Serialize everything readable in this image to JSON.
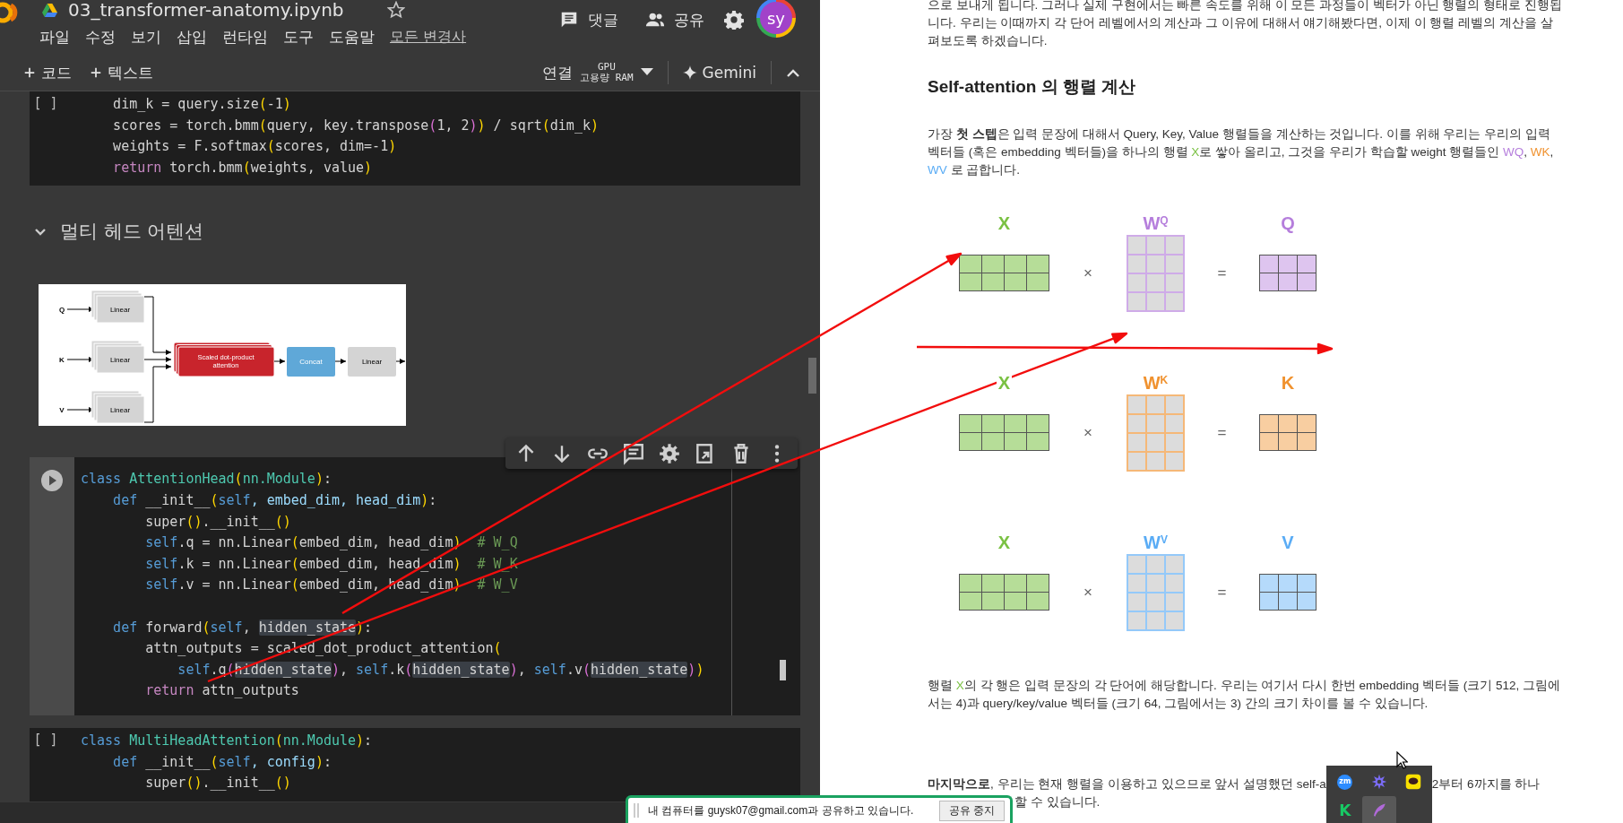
{
  "notebook": {
    "title": "03_transformer-anatomy.ipynb",
    "starred": false,
    "menu": [
      "파일",
      "수정",
      "보기",
      "삽입",
      "런타임",
      "도구",
      "도움말"
    ],
    "save_status": "모든 변경사",
    "actions": [
      {
        "kind": "comment",
        "label": "댓글"
      },
      {
        "kind": "share",
        "label": "공유"
      }
    ],
    "avatar_initials": "sy",
    "toolbar": {
      "insert_buttons": [
        "코드",
        "텍스트"
      ],
      "connect_label": "연결",
      "gpu_label": "GPU",
      "ram_label": "고용량 RAM",
      "assistant_label": "Gemini"
    },
    "cells": [
      {
        "kind": "code",
        "focused": false,
        "run_label": "[ ]",
        "lines": [
          {
            "kind": "code",
            "tokens": [
              {
                "text": "    dim_k = query.size",
                "kind": "plain"
              },
              {
                "text": "(",
                "kind": "bracket"
              },
              {
                "text": "-1",
                "kind": "plain"
              },
              {
                "text": ")",
                "kind": "bracket"
              }
            ]
          },
          {
            "kind": "code",
            "tokens": [
              {
                "text": "    scores = torch.bmm",
                "kind": "plain"
              },
              {
                "text": "(",
                "kind": "bracket"
              },
              {
                "text": "query, key.transpose",
                "kind": "plain"
              },
              {
                "text": "(",
                "kind": "bracket2"
              },
              {
                "text": "1, 2",
                "kind": "plain"
              },
              {
                "text": ")",
                "kind": "bracket2"
              },
              {
                "text": ")",
                "kind": "bracket"
              },
              {
                "text": " / sqrt",
                "kind": "plain"
              },
              {
                "text": "(",
                "kind": "bracket"
              },
              {
                "text": "dim_k",
                "kind": "plain"
              },
              {
                "text": ")",
                "kind": "bracket"
              }
            ]
          },
          {
            "kind": "code",
            "tokens": [
              {
                "text": "    weights = F.softmax",
                "kind": "plain"
              },
              {
                "text": "(",
                "kind": "bracket"
              },
              {
                "text": "scores, dim=-1",
                "kind": "plain"
              },
              {
                "text": ")",
                "kind": "bracket"
              }
            ]
          },
          {
            "kind": "code",
            "tokens": [
              {
                "text": "    return",
                "kind": "control"
              },
              {
                "text": " torch.bmm",
                "kind": "plain"
              },
              {
                "text": "(",
                "kind": "bracket"
              },
              {
                "text": "weights, value",
                "kind": "plain"
              },
              {
                "text": ")",
                "kind": "bracket"
              }
            ]
          }
        ]
      },
      {
        "kind": "heading",
        "expanded": true,
        "text": "멀티 헤드 어텐션"
      },
      {
        "kind": "image",
        "inputs": [
          "Q",
          "K",
          "V"
        ],
        "projections": [
          "Linear",
          "Linear",
          "Linear"
        ],
        "attention_lines": [
          "Scaled dot-product",
          "attention"
        ],
        "concat_label": "Concat",
        "output_label": "Linear"
      },
      {
        "kind": "code",
        "focused": true,
        "lines": [
          {
            "kind": "code",
            "tokens": [
              {
                "text": "class ",
                "kind": "keyword"
              },
              {
                "text": "AttentionHead",
                "kind": "type"
              },
              {
                "text": "(",
                "kind": "bracket"
              },
              {
                "text": "nn.Module",
                "kind": "type"
              },
              {
                "text": ")",
                "kind": "bracket"
              },
              {
                "text": ":",
                "kind": "plain"
              }
            ]
          },
          {
            "kind": "code",
            "tokens": [
              {
                "text": "    def",
                "kind": "keyword"
              },
              {
                "text": " __init__",
                "kind": "plain"
              },
              {
                "text": "(",
                "kind": "bracket"
              },
              {
                "text": "self",
                "kind": "keyword"
              },
              {
                "text": ", embed_dim, head_dim",
                "kind": "param"
              },
              {
                "text": ")",
                "kind": "bracket"
              },
              {
                "text": ":",
                "kind": "plain"
              }
            ]
          },
          {
            "kind": "code",
            "tokens": [
              {
                "text": "        super",
                "kind": "plain"
              },
              {
                "text": "()",
                "kind": "bracket"
              },
              {
                "text": ".__init__",
                "kind": "plain"
              },
              {
                "text": "()",
                "kind": "bracket"
              }
            ]
          },
          {
            "kind": "code",
            "tokens": [
              {
                "text": "        self",
                "kind": "keyword"
              },
              {
                "text": ".q = nn.Linear",
                "kind": "plain"
              },
              {
                "text": "(",
                "kind": "bracket"
              },
              {
                "text": "embed_dim, head_dim",
                "kind": "plain"
              },
              {
                "text": ")",
                "kind": "bracket"
              },
              {
                "text": "  # W_Q",
                "kind": "comment"
              }
            ]
          },
          {
            "kind": "code",
            "tokens": [
              {
                "text": "        self",
                "kind": "keyword"
              },
              {
                "text": ".k = nn.Linear",
                "kind": "plain"
              },
              {
                "text": "(",
                "kind": "bracket"
              },
              {
                "text": "embed_dim, head_dim",
                "kind": "plain"
              },
              {
                "text": ")",
                "kind": "bracket"
              },
              {
                "text": "  # W_K",
                "kind": "comment"
              }
            ]
          },
          {
            "kind": "code",
            "tokens": [
              {
                "text": "        self",
                "kind": "keyword"
              },
              {
                "text": ".v = nn.Linear",
                "kind": "plain"
              },
              {
                "text": "(",
                "kind": "bracket"
              },
              {
                "text": "embed_dim, head_dim",
                "kind": "plain"
              },
              {
                "text": ")",
                "kind": "bracket"
              },
              {
                "text": "  # W_V",
                "kind": "comment"
              }
            ]
          },
          {
            "kind": "blank"
          },
          {
            "kind": "code",
            "tokens": [
              {
                "text": "    def",
                "kind": "keyword"
              },
              {
                "text": " forward",
                "kind": "plain"
              },
              {
                "text": "(",
                "kind": "bracket"
              },
              {
                "text": "self",
                "kind": "keyword"
              },
              {
                "text": ", ",
                "kind": "plain"
              },
              {
                "text": "hidden_state",
                "kind": "match"
              },
              {
                "text": ")",
                "kind": "bracket"
              },
              {
                "text": ":",
                "kind": "plain"
              }
            ]
          },
          {
            "kind": "code",
            "tokens": [
              {
                "text": "        attn_outputs = scaled_dot_product_attention",
                "kind": "plain"
              },
              {
                "text": "(",
                "kind": "bracket"
              }
            ]
          },
          {
            "kind": "code",
            "tokens": [
              {
                "text": "            self",
                "kind": "keyword"
              },
              {
                "text": ".q",
                "kind": "plain"
              },
              {
                "text": "(",
                "kind": "bracket2"
              },
              {
                "text": "hidden_state",
                "kind": "match"
              },
              {
                "text": ")",
                "kind": "bracket2"
              },
              {
                "text": ", ",
                "kind": "plain"
              },
              {
                "text": "self",
                "kind": "keyword"
              },
              {
                "text": ".k",
                "kind": "plain"
              },
              {
                "text": "(",
                "kind": "bracket2"
              },
              {
                "text": "hidden_state",
                "kind": "match"
              },
              {
                "text": ")",
                "kind": "bracket2"
              },
              {
                "text": ", ",
                "kind": "plain"
              },
              {
                "text": "self",
                "kind": "keyword"
              },
              {
                "text": ".v",
                "kind": "plain"
              },
              {
                "text": "(",
                "kind": "bracket2"
              },
              {
                "text": "hidden_state",
                "kind": "match"
              },
              {
                "text": ")",
                "kind": "bracket2"
              },
              {
                "text": ")",
                "kind": "bracket"
              }
            ]
          },
          {
            "kind": "code",
            "tokens": [
              {
                "text": "        return",
                "kind": "control"
              },
              {
                "text": " attn_outputs",
                "kind": "plain"
              }
            ]
          }
        ]
      },
      {
        "kind": "code",
        "focused": false,
        "run_label": "[ ]",
        "lines": [
          {
            "kind": "code",
            "tokens": [
              {
                "text": "class ",
                "kind": "keyword"
              },
              {
                "text": "MultiHeadAttention",
                "kind": "type"
              },
              {
                "text": "(",
                "kind": "bracket"
              },
              {
                "text": "nn.Module",
                "kind": "type"
              },
              {
                "text": ")",
                "kind": "bracket"
              },
              {
                "text": ":",
                "kind": "plain"
              }
            ]
          },
          {
            "kind": "code",
            "tokens": [
              {
                "text": "    def",
                "kind": "keyword"
              },
              {
                "text": " __init__",
                "kind": "plain"
              },
              {
                "text": "(",
                "kind": "bracket"
              },
              {
                "text": "self",
                "kind": "keyword"
              },
              {
                "text": ", config",
                "kind": "param"
              },
              {
                "text": ")",
                "kind": "bracket"
              },
              {
                "text": ":",
                "kind": "plain"
              }
            ]
          },
          {
            "kind": "code",
            "tokens": [
              {
                "text": "        super",
                "kind": "plain"
              },
              {
                "text": "()",
                "kind": "bracket"
              },
              {
                "text": ".__init__",
                "kind": "plain"
              },
              {
                "text": "()",
                "kind": "bracket"
              }
            ]
          }
        ]
      }
    ]
  },
  "document": {
    "intro": [
      {
        "text": "으로 보내게 됩니다. 그러나 실제 구현에서는 빠른 속도를 위해 이 모든 과정들이 벡터가 아닌 행렬의 형태로 진행됩니다. 우리는 이때까지 각 단어 레벨에서의 계산과 그 이유에 대해서 얘기해봤다면, 이제 이 행렬 레벨의 계산을 살펴보도록 하겠습니다.",
        "kind": "plain"
      }
    ],
    "heading": "Self-attention 의 행렬 계산",
    "paragraph": [
      {
        "text": "가장 ",
        "kind": "plain"
      },
      {
        "text": "첫 스텝",
        "kind": "bold"
      },
      {
        "text": "은 입력 문장에 대해서 Query, Key, Value 행렬들을 계산하는 것입니다. 이를 위해 우리는 우리의 입력 벡터들 (혹은 embedding 벡터들)을 하나의 행렬 ",
        "kind": "plain"
      },
      {
        "text": "X",
        "kind": "input"
      },
      {
        "text": "로 쌓아 올리고, 그것을 우리가 학습할 weight 행렬들인 ",
        "kind": "plain"
      },
      {
        "text": "WQ",
        "kind": "query"
      },
      {
        "text": ", ",
        "kind": "plain"
      },
      {
        "text": "WK",
        "kind": "key"
      },
      {
        "text": ", ",
        "kind": "plain"
      },
      {
        "text": "WV",
        "kind": "value"
      },
      {
        "text": " 로 곱합니다.",
        "kind": "plain"
      }
    ],
    "diagram": {
      "input": {
        "color": "#7ac143"
      },
      "rows": [
        {
          "input_label": "X",
          "times": "×",
          "weight_label": "W$^{Q}$",
          "equals": "=",
          "output_label": "Q",
          "color": "#b57edc"
        },
        {
          "input_label": "X",
          "times": "×",
          "weight_label": "W$^{K}$",
          "equals": "=",
          "output_label": "K",
          "color": "#f0922f"
        },
        {
          "input_label": "X",
          "times": "×",
          "weight_label": "W$^{V}$",
          "equals": "=",
          "output_label": "V",
          "color": "#5aacf5"
        }
      ]
    },
    "note": [
      {
        "text": "행렬 ",
        "kind": "plain"
      },
      {
        "text": "X",
        "kind": "input"
      },
      {
        "text": "의 각 행은 입력 문장의 각 단어에 해당합니다. 우리는 여기서 다시 한번 embedding 벡터들 (크기 512, 그림에서는 4)과 query/key/value 벡터들 (크기 64, 그림에서는 3) 간의 크기 차이를 볼 수 있습니다.",
        "kind": "plain"
      }
    ],
    "closing_lines": [
      [
        "**마지막으로**, 우리는 현재 행렬을 이용하고 있으므로 앞서 설명했던 self-a",
        "2부터 6까지를 하나"
      ],
      [
        "할 수 있습니다."
      ]
    ]
  },
  "share_banner": {
    "message": "내 컴퓨터를 guysk07@gmail.com과 공유하고 있습니다.",
    "button": "공유 중지"
  },
  "tray_icons": [
    {
      "kind": "meeting",
      "label": "zm",
      "selected": false
    },
    {
      "kind": "burst",
      "selected": false
    },
    {
      "kind": "chat",
      "selected": false
    },
    {
      "kind": "letter",
      "label": "K",
      "selected": false
    },
    {
      "kind": "feather",
      "selected": true
    }
  ]
}
